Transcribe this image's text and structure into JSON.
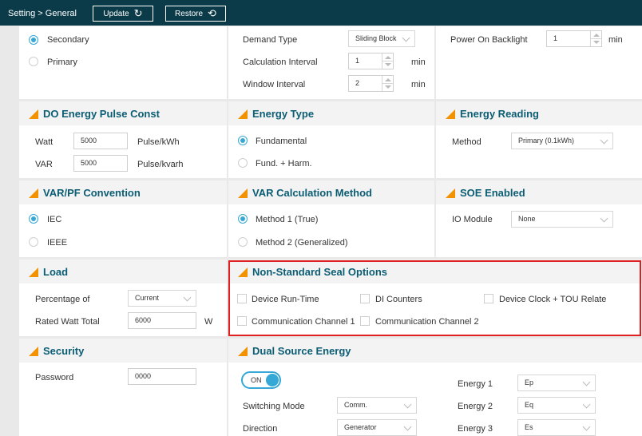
{
  "topbar": {
    "breadcrumb": "Setting > General",
    "update_label": "Update",
    "update_icon": "refresh-icon",
    "restore_label": "Restore",
    "restore_icon": "history-icon"
  },
  "top_left": {
    "options": [
      {
        "label": "Secondary",
        "selected": true
      },
      {
        "label": "Primary",
        "selected": false
      }
    ]
  },
  "demand": {
    "type_label": "Demand Type",
    "type_value": "Sliding Block",
    "calc_label": "Calculation Interval",
    "calc_value": "1",
    "calc_unit": "min",
    "window_label": "Window Interval",
    "window_value": "2",
    "window_unit": "min"
  },
  "backlight": {
    "label": "Power On Backlight",
    "value": "1",
    "unit": "min"
  },
  "do_energy": {
    "title": "DO Energy Pulse Const",
    "watt_label": "Watt",
    "watt_value": "5000",
    "watt_unit": "Pulse/kWh",
    "var_label": "VAR",
    "var_value": "5000",
    "var_unit": "Pulse/kvarh"
  },
  "energy_type": {
    "title": "Energy Type",
    "options": [
      {
        "label": "Fundamental",
        "selected": true
      },
      {
        "label": "Fund. + Harm.",
        "selected": false
      }
    ]
  },
  "energy_reading": {
    "title": "Energy Reading",
    "method_label": "Method",
    "method_value": "Primary (0.1kWh)"
  },
  "var_pf": {
    "title": "VAR/PF Convention",
    "options": [
      {
        "label": "IEC",
        "selected": true
      },
      {
        "label": "IEEE",
        "selected": false
      }
    ]
  },
  "var_calc": {
    "title": "VAR Calculation Method",
    "options": [
      {
        "label": "Method 1 (True)",
        "selected": true
      },
      {
        "label": "Method 2 (Generalized)",
        "selected": false
      }
    ]
  },
  "soe": {
    "title": "SOE Enabled",
    "io_label": "IO Module",
    "io_value": "None"
  },
  "load": {
    "title": "Load",
    "pct_label": "Percentage of",
    "pct_value": "Current",
    "rated_label": "Rated Watt Total",
    "rated_value": "6000",
    "rated_unit": "W"
  },
  "seal": {
    "title": "Non-Standard Seal Options",
    "options": [
      {
        "label": "Device Run-Time"
      },
      {
        "label": "DI Counters"
      },
      {
        "label": "Device Clock + TOU Relate"
      },
      {
        "label": "Communication Channel 1"
      },
      {
        "label": "Communication Channel 2"
      }
    ]
  },
  "security": {
    "title": "Security",
    "password_label": "Password",
    "password_value": "0000"
  },
  "dual_source": {
    "title": "Dual Source Energy",
    "toggle_label": "ON",
    "switching_label": "Switching Mode",
    "switching_value": "Comm.",
    "direction_label": "Direction",
    "direction_value": "Generator",
    "energy1_label": "Energy 1",
    "energy1_value": "Ep",
    "energy2_label": "Energy 2",
    "energy2_value": "Eq",
    "energy3_label": "Energy 3",
    "energy3_value": "Es"
  },
  "colors": {
    "topbar": "#0b3b48",
    "accent": "#f39200",
    "heading": "#0b5d74",
    "radio": "#36a8d6",
    "highlight": "#e02020"
  }
}
